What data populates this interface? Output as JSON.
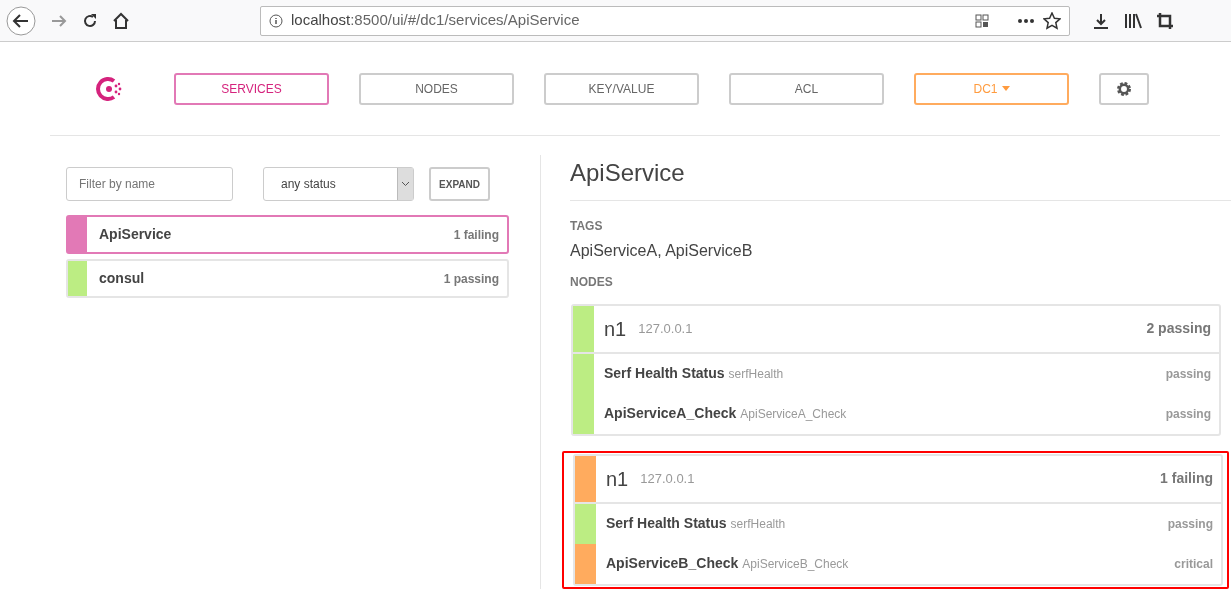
{
  "browser": {
    "url_host": "localhost",
    "url_rest": ":8500/ui/#/dc1/services/ApiService"
  },
  "nav": [
    {
      "label": "SERVICES",
      "selected": true,
      "kind": "tab"
    },
    {
      "label": "NODES",
      "selected": false,
      "kind": "tab"
    },
    {
      "label": "KEY/VALUE",
      "selected": false,
      "kind": "tab"
    },
    {
      "label": "ACL",
      "selected": false,
      "kind": "tab"
    },
    {
      "label": "DC1",
      "selected": false,
      "kind": "dropdown"
    },
    {
      "selected": false,
      "kind": "settings"
    }
  ],
  "filter": {
    "placeholder": "Filter by name",
    "status": "any status",
    "expand": "EXPAND"
  },
  "services": [
    {
      "name": "ApiService",
      "summary": "1 failing",
      "color": "#e279b6",
      "selected": true
    },
    {
      "name": "consul",
      "summary": "1 passing",
      "color": "#bced83",
      "selected": false
    }
  ],
  "detail": {
    "title": "ApiService",
    "tags_label": "TAGS",
    "tags": "ApiServiceA, ApiServiceB",
    "nodes_label": "NODES",
    "nodes": [
      {
        "name": "n1",
        "address": "127.0.0.1",
        "summary": "2 passing",
        "color": "#bced83",
        "highlighted": false,
        "checks": [
          {
            "name": "Serf Health Status",
            "id": "serfHealth",
            "status_text": "passing",
            "color": "#bced83"
          },
          {
            "name": "ApiServiceA_Check",
            "id": "ApiServiceA_Check",
            "status_text": "passing",
            "color": "#bced83"
          }
        ]
      },
      {
        "name": "n1",
        "address": "127.0.0.1",
        "summary": "1 failing",
        "color": "#ffab5e",
        "highlighted": true,
        "checks": [
          {
            "name": "Serf Health Status",
            "id": "serfHealth",
            "status_text": "passing",
            "color": "#bced83"
          },
          {
            "name": "ApiServiceB_Check",
            "id": "ApiServiceB_Check",
            "status_text": "critical",
            "color": "#ffab5e"
          }
        ]
      }
    ]
  }
}
